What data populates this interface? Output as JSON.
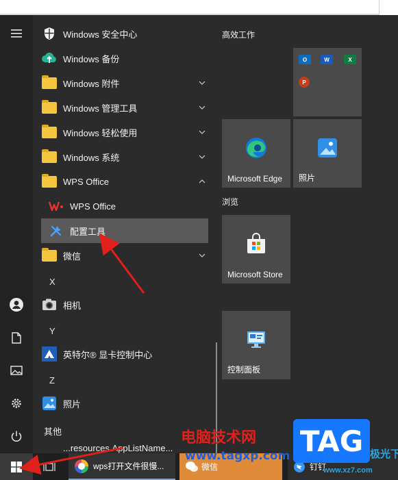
{
  "rail": {
    "items": [
      {
        "name": "hamburger-menu-icon",
        "glyph": "☰"
      },
      {
        "name": "user-avatar-icon",
        "glyph": "user"
      },
      {
        "name": "documents-icon",
        "glyph": "doc"
      },
      {
        "name": "pictures-icon",
        "glyph": "pic"
      },
      {
        "name": "settings-icon",
        "glyph": "⚙"
      },
      {
        "name": "power-icon",
        "glyph": "⏻"
      }
    ]
  },
  "apps": [
    {
      "label": "Windows 安全中心",
      "icon": "shield-icon",
      "chevron": false
    },
    {
      "label": "Windows 备份",
      "icon": "cloud-backup-icon",
      "chevron": false
    },
    {
      "label": "Windows 附件",
      "icon": "folder-icon",
      "chevron": "down"
    },
    {
      "label": "Windows 管理工具",
      "icon": "folder-icon",
      "chevron": "down"
    },
    {
      "label": "Windows 轻松使用",
      "icon": "folder-icon",
      "chevron": "down"
    },
    {
      "label": "Windows 系统",
      "icon": "folder-icon",
      "chevron": "down"
    },
    {
      "label": "WPS Office",
      "icon": "folder-icon",
      "chevron": "up"
    },
    {
      "label": "WPS Office",
      "icon": "wps-logo-icon",
      "chevron": false
    },
    {
      "label": "配置工具",
      "icon": "tools-icon",
      "chevron": false
    },
    {
      "label": "微信",
      "icon": "folder-icon",
      "chevron": "down"
    }
  ],
  "letters": {
    "x": "X",
    "y": "Y",
    "z": "Z",
    "other": "其他"
  },
  "apps_x": [
    {
      "label": "相机",
      "icon": "camera-icon"
    }
  ],
  "apps_y": [
    {
      "label": "英特尔® 显卡控制中心",
      "icon": "intel-graphics-icon"
    }
  ],
  "apps_z": [
    {
      "label": "照片",
      "icon": "photos-icon"
    }
  ],
  "partial_row": "...resources.AppListName...",
  "groups": {
    "productivity": "高效工作",
    "browse": "浏览"
  },
  "tiles": {
    "edge": "Microsoft Edge",
    "photos": "照片",
    "store": "Microsoft Store",
    "control_panel": "控制面板",
    "office_minis": [
      "O",
      "W",
      "X",
      "P"
    ]
  },
  "taskbar": {
    "wps_title": "wps打开文件很慢...",
    "wechat": "微信",
    "dingtalk": "钉钉"
  },
  "watermark": {
    "site_cn": "电脑技术网",
    "url": "www.tagxp.com",
    "tag": "TAG",
    "station": "极光下载站",
    "url2": "www.xz7.com"
  },
  "colors": {
    "menu_bg": "#2b2b2b",
    "tile_bg": "#4a4a4a",
    "folder": "#f7c63f",
    "arrow": "#e0201b"
  }
}
